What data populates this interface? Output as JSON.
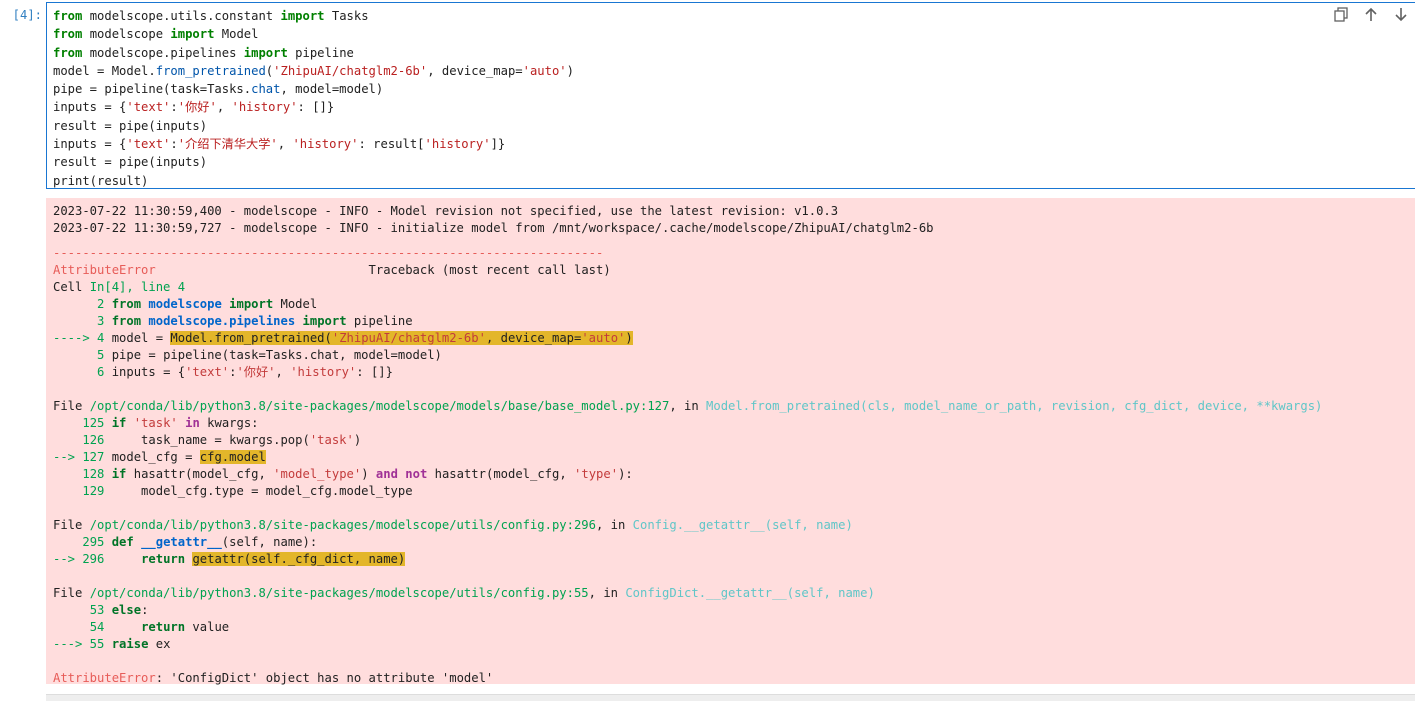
{
  "cell": {
    "prompt": "[4]:",
    "code": [
      "from modelscope.utils.constant import Tasks",
      "from modelscope import Model",
      "from modelscope.pipelines import pipeline",
      "model = Model.from_pretrained('ZhipuAI/chatglm2-6b', device_map='auto')",
      "pipe = pipeline(task=Tasks.chat, model=model)",
      "inputs = {'text':'你好', 'history': []}",
      "result = pipe(inputs)",
      "inputs = {'text':'介绍下清华大学', 'history': result['history']}",
      "result = pipe(inputs)",
      "print(result)"
    ]
  },
  "toolbar": {
    "copy_icon": "copy-icon",
    "up_icon": "arrow-up-icon",
    "down_icon": "arrow-down-icon"
  },
  "output": {
    "log1": "2023-07-22 11:30:59,400 - modelscope - INFO - Model revision not specified, use the latest revision: v1.0.3",
    "log2": "2023-07-22 11:30:59,727 - modelscope - INFO - initialize model from /mnt/workspace/.cache/modelscope/ZhipuAI/chatglm2-6b",
    "separator": "---------------------------------------------------------------------------",
    "err_name": "AttributeError",
    "traceback_label": "Traceback (most recent call last)",
    "cell_ref_prefix": "Cell ",
    "cell_ref": "In[4], line 4",
    "frame1_file": "/opt/conda/lib/python3.8/site-packages/modelscope/models/base/base_model.py:127",
    "frame1_func": "Model.from_pretrained(cls, model_name_or_path, revision, cfg_dict, device, **kwargs)",
    "frame2_file": "/opt/conda/lib/python3.8/site-packages/modelscope/utils/config.py:296",
    "frame2_func": "Config.__getattr__(self, name)",
    "frame3_file": "/opt/conda/lib/python3.8/site-packages/modelscope/utils/config.py:55",
    "frame3_func": "ConfigDict.__getattr__(self, name)",
    "final_error_msg": ": 'ConfigDict' object has no attribute 'model'"
  }
}
